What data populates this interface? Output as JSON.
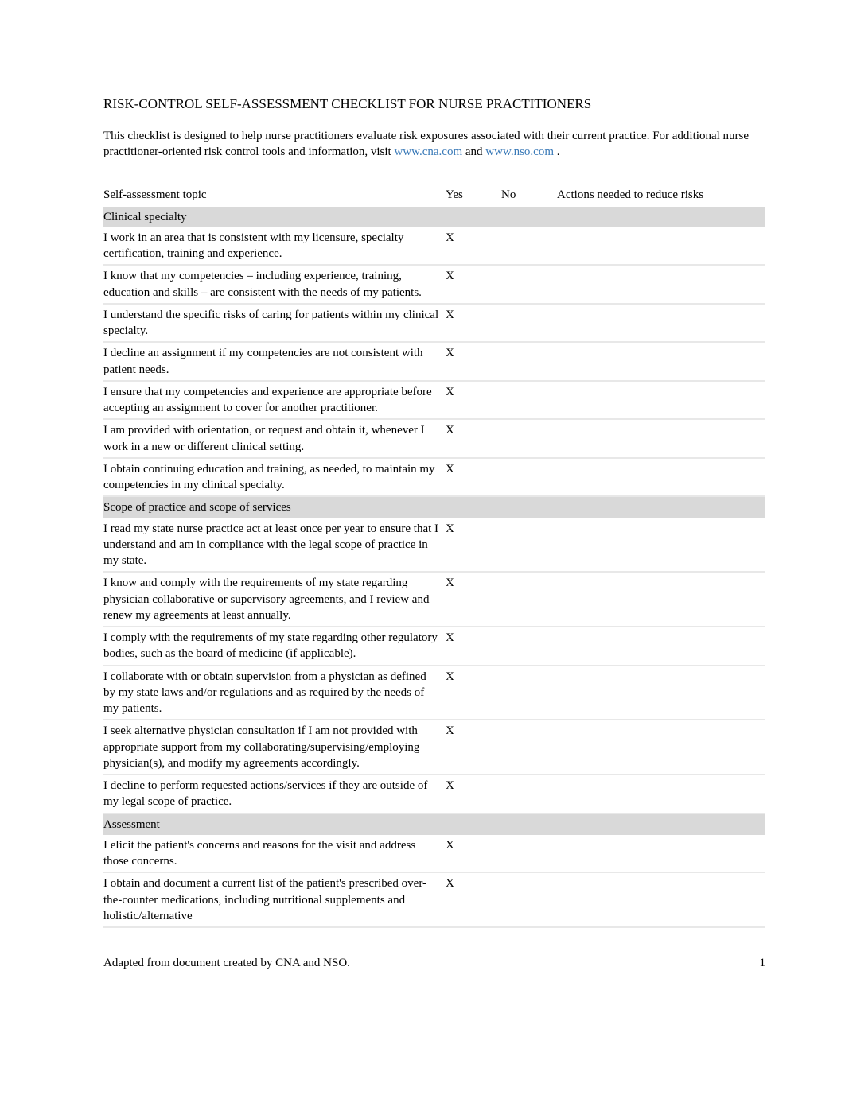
{
  "title": "RISK-CONTROL SELF-ASSESSMENT CHECKLIST FOR NURSE PRACTITIONERS",
  "intro": {
    "part1": "This checklist is designed to help nurse practitioners evaluate risk exposures associated with their current practice. For additional nurse practitioner-oriented risk control tools and information, visit ",
    "link1": "www.cna.com",
    "part2": " and ",
    "link2": "www.nso.com",
    "part3": " ."
  },
  "headers": {
    "topic": "Self-assessment topic",
    "yes": "Yes",
    "no": "No",
    "actions": "Actions needed to reduce risks"
  },
  "sections": [
    {
      "label": "Clinical specialty",
      "items": [
        {
          "text": "I work in an area that is consistent with my licensure, specialty certification, training and experience.",
          "yes": "X",
          "no": "",
          "actions": ""
        },
        {
          "text": "I know that my competencies – including experience, training, education and skills – are consistent with the needs of my patients.",
          "yes": "X",
          "no": "",
          "actions": ""
        },
        {
          "text": "I understand the specific risks of caring for patients within my clinical specialty.",
          "yes": "X",
          "no": "",
          "actions": ""
        },
        {
          "text": "I decline an assignment if my competencies are not consistent with patient needs.",
          "yes": "X",
          "no": "",
          "actions": ""
        },
        {
          "text": "I ensure that my competencies and experience are appropriate before accepting an assignment to cover for another practitioner.",
          "yes": "X",
          "no": "",
          "actions": ""
        },
        {
          "text": "I am provided with orientation, or request and obtain it, whenever I work in a new or different clinical setting.",
          "yes": "X",
          "no": "",
          "actions": ""
        },
        {
          "text": "I obtain continuing education and training, as needed, to maintain my competencies in my clinical specialty.",
          "yes": "X",
          "no": "",
          "actions": ""
        }
      ]
    },
    {
      "label": "Scope of practice and scope of services",
      "items": [
        {
          "text": "I read my state nurse practice act at least once per year to ensure that I understand and am in compliance with the legal scope of practice in my state.",
          "yes": "X",
          "no": "",
          "actions": ""
        },
        {
          "text": "I know and comply with the requirements of my state regarding physician collaborative or supervisory agreements, and I review and renew my agreements at least annually.",
          "yes": "X",
          "no": "",
          "actions": ""
        },
        {
          "text": "I comply with the requirements of my state regarding other regulatory bodies, such as the board of medicine (if applicable).",
          "yes": "X",
          "no": "",
          "actions": ""
        },
        {
          "text": "I collaborate with or obtain supervision from a physician as defined by my state laws and/or regulations and as required by the needs of my patients.",
          "yes": "X",
          "no": "",
          "actions": ""
        },
        {
          "text": "I seek alternative physician consultation if I am not provided with appropriate support from my collaborating/supervising/employing physician(s), and modify my agreements accordingly.",
          "yes": "X",
          "no": "",
          "actions": ""
        },
        {
          "text": "I decline to perform requested actions/services if they are outside of my legal scope of practice.",
          "yes": "X",
          "no": "",
          "actions": ""
        }
      ]
    },
    {
      "label": "Assessment",
      "items": [
        {
          "text": "I elicit the patient's concerns and reasons for the visit and address those concerns.",
          "yes": "X",
          "no": "",
          "actions": ""
        },
        {
          "text": "I obtain and document a current list of the patient's prescribed over-the-counter medications, including nutritional supplements and holistic/alternative",
          "yes": "X",
          "no": "",
          "actions": ""
        }
      ]
    }
  ],
  "footer": {
    "left": "Adapted from document created by CNA and NSO.",
    "right": "1"
  }
}
